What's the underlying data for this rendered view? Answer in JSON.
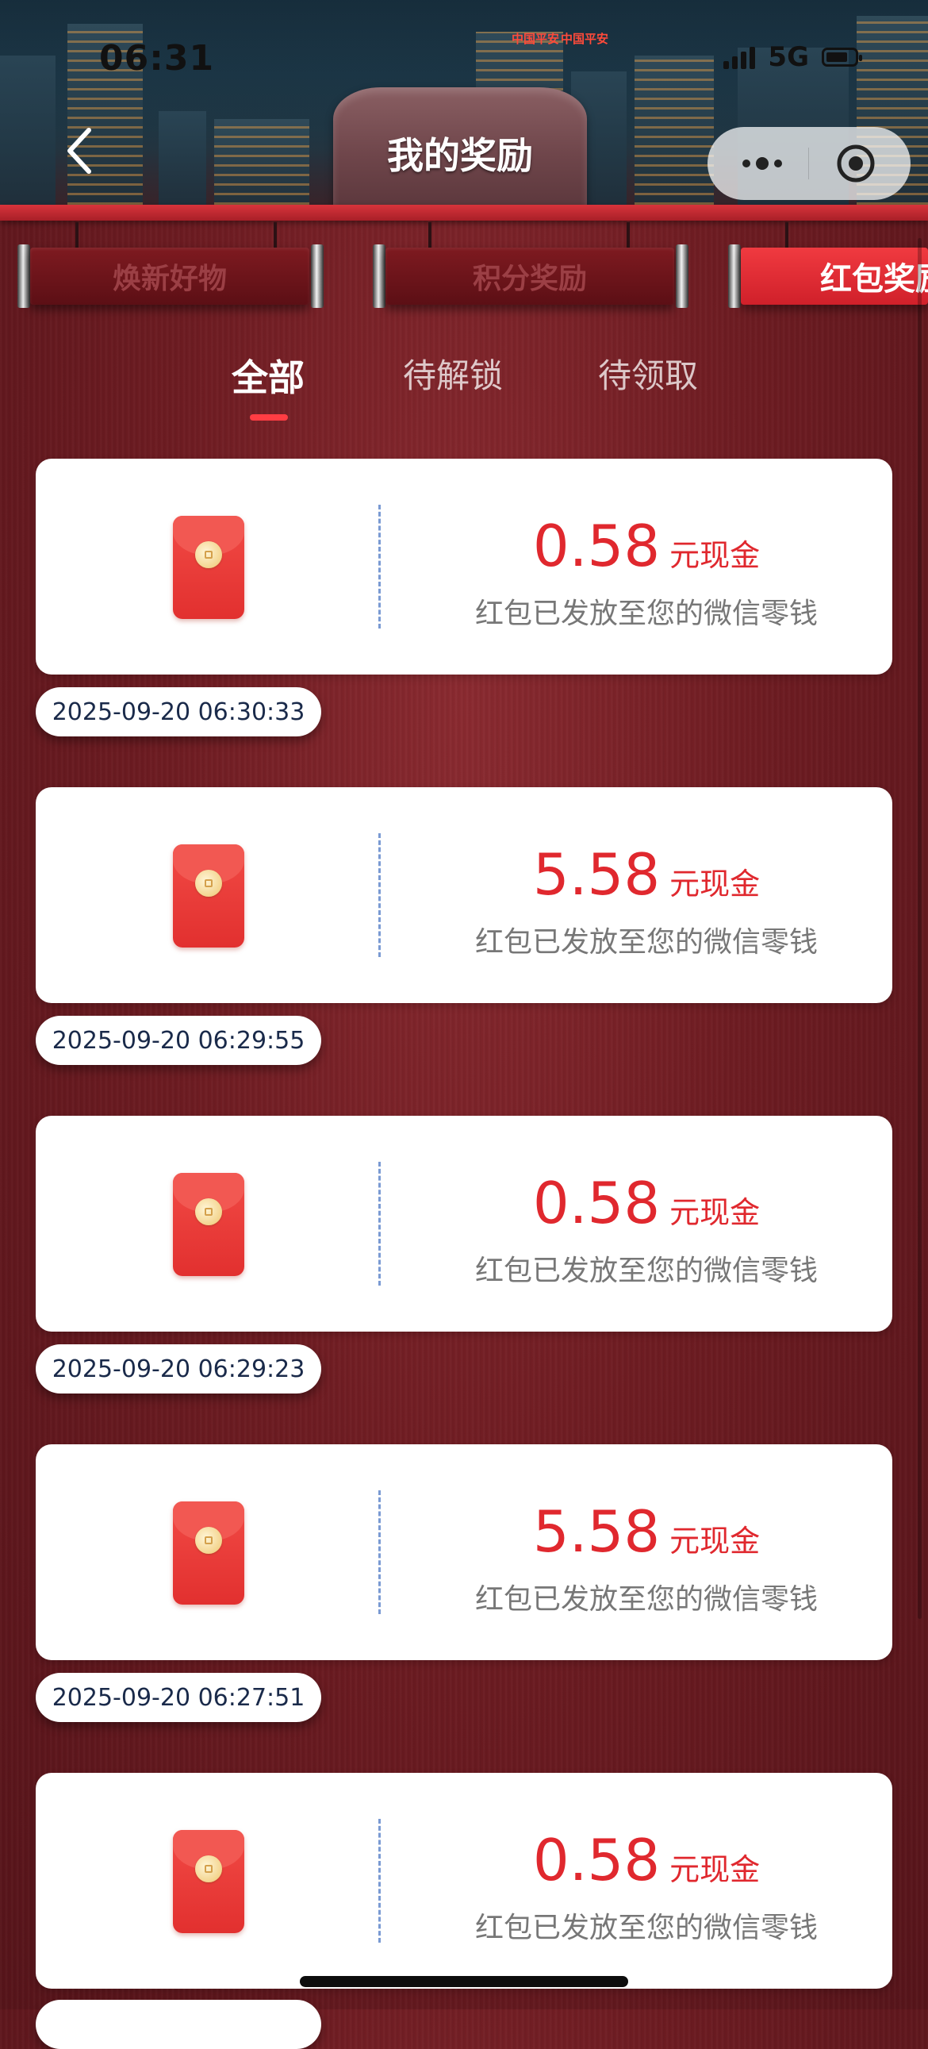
{
  "status_bar": {
    "time": "06:31",
    "network": "5G"
  },
  "nav": {
    "title": "我的奖励"
  },
  "category_tabs": [
    {
      "label": "焕新好物",
      "active": false
    },
    {
      "label": "积分奖励",
      "active": false
    },
    {
      "label": "红包奖励",
      "active": true
    }
  ],
  "sub_tabs": [
    {
      "label": "全部",
      "active": true
    },
    {
      "label": "待解锁",
      "active": false
    },
    {
      "label": "待领取",
      "active": false
    }
  ],
  "rewards": [
    {
      "amount": "0.58",
      "unit": "元现金",
      "desc": "红包已发放至您的微信零钱",
      "time": "2025-09-20 06:30:33"
    },
    {
      "amount": "5.58",
      "unit": "元现金",
      "desc": "红包已发放至您的微信零钱",
      "time": "2025-09-20 06:29:55"
    },
    {
      "amount": "0.58",
      "unit": "元现金",
      "desc": "红包已发放至您的微信零钱",
      "time": "2025-09-20 06:29:23"
    },
    {
      "amount": "5.58",
      "unit": "元现金",
      "desc": "红包已发放至您的微信零钱",
      "time": "2025-09-20 06:27:51"
    },
    {
      "amount": "0.58",
      "unit": "元现金",
      "desc": "红包已发放至您的微信零钱",
      "time": ""
    }
  ],
  "colors": {
    "accent_red": "#e0282e",
    "tab_active": "#f03a40",
    "background": "#6e1c22"
  }
}
